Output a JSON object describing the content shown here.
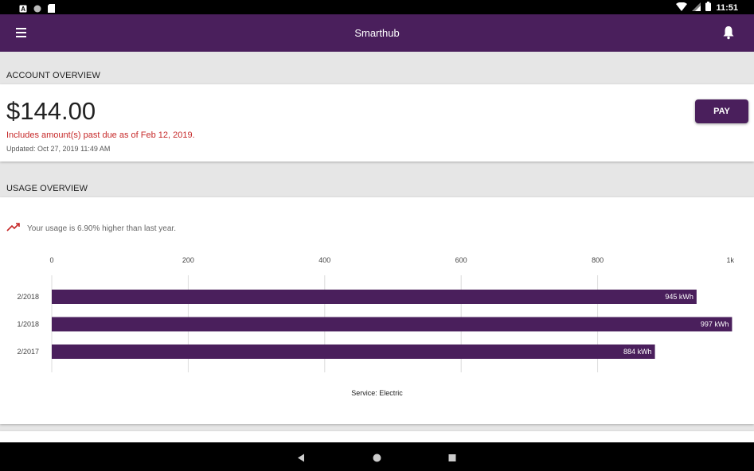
{
  "statusbar": {
    "time": "11:51"
  },
  "appbar": {
    "title": "Smarthub"
  },
  "account": {
    "section_title": "ACCOUNT OVERVIEW",
    "amount": "$144.00",
    "past_due": "Includes amount(s) past due as of Feb 12, 2019.",
    "updated": "Updated:  Oct 27, 2019 11:49 AM",
    "pay_label": "PAY"
  },
  "usage": {
    "section_title": "USAGE OVERVIEW",
    "trend_text": "Your usage is 6.90% higher than last year.",
    "footnote": "Service: Electric"
  },
  "colors": {
    "brand": "#4a1f5c",
    "alert": "#c62828"
  },
  "chart_data": {
    "type": "bar",
    "orientation": "horizontal",
    "categories": [
      "2/2018",
      "1/2018",
      "2/2017"
    ],
    "values": [
      945,
      997,
      884
    ],
    "value_labels": [
      "945 kWh",
      "997 kWh",
      "884 kWh"
    ],
    "xlim": [
      0,
      1000
    ],
    "x_ticks": [
      0,
      200,
      400,
      600,
      800,
      1000
    ],
    "x_tick_labels": [
      "0",
      "200",
      "400",
      "600",
      "800",
      "1k"
    ],
    "grid": true
  }
}
